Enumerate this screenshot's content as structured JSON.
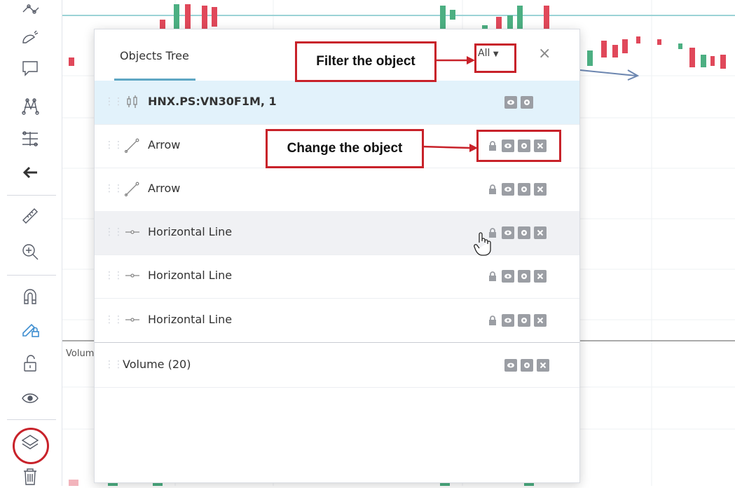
{
  "toolbar": {
    "icons": [
      "trend-line-icon",
      "curve-icon",
      "callout-icon",
      "pattern-icon",
      "fib-icon",
      "back-arrow-icon",
      "ruler-icon",
      "zoom-in-icon",
      "magnet-icon",
      "lock-drawing-icon",
      "unlock-icon",
      "eye-icon",
      "layers-icon",
      "trash-icon"
    ]
  },
  "chart": {
    "volume_label": "Volum"
  },
  "panel": {
    "title": "Objects Tree",
    "filter_label": "All",
    "close_label": "×",
    "rows": [
      {
        "label": "HNX.PS:VN30F1M, 1",
        "icon": "candles-icon"
      },
      {
        "label": "Arrow",
        "icon": "arrow-tool-icon"
      },
      {
        "label": "Arrow",
        "icon": "arrow-tool-icon"
      },
      {
        "label": "Horizontal Line",
        "icon": "hline-icon"
      },
      {
        "label": "Horizontal Line",
        "icon": "hline-icon"
      },
      {
        "label": "Horizontal Line",
        "icon": "hline-icon"
      },
      {
        "label": "Volume (20)"
      }
    ]
  },
  "annotations": {
    "filter_callout": "Filter the object",
    "change_callout": "Change the object"
  },
  "colors": {
    "accent": "#5fa7c4",
    "callout_red": "#c8222a",
    "candle_up": "#4caf82",
    "candle_down": "#e0485a",
    "row_highlight": "#e2f2fb"
  }
}
